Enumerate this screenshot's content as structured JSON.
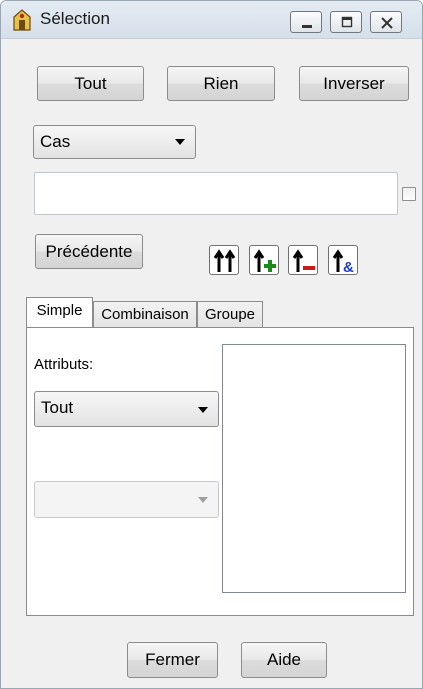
{
  "window": {
    "title": "Sélection",
    "icons": {
      "app": "app-icon",
      "minimize": "minimize-icon",
      "maximize": "maximize-icon",
      "close": "close-icon"
    }
  },
  "toolbar": {
    "all_label": "Tout",
    "none_label": "Rien",
    "invert_label": "Inverser"
  },
  "case_combo": {
    "value": "Cas"
  },
  "expression_input": {
    "value": ""
  },
  "previous_button": {
    "label": "Précédente"
  },
  "icon_buttons": [
    "move-all-up-icon",
    "add-up-icon",
    "remove-up-icon",
    "and-up-icon"
  ],
  "tabs": [
    {
      "label": "Simple",
      "active": true
    },
    {
      "label": "Combinaison",
      "active": false
    },
    {
      "label": "Groupe",
      "active": false
    }
  ],
  "simple": {
    "attributes_label": "Attributs:",
    "attributes_combo": "Tout",
    "value_combo": ""
  },
  "footer": {
    "close_label": "Fermer",
    "help_label": "Aide"
  },
  "colors": {
    "plus_green": "#1a8c1a",
    "minus_red": "#d01818",
    "amp_blue": "#1a3cc8"
  }
}
